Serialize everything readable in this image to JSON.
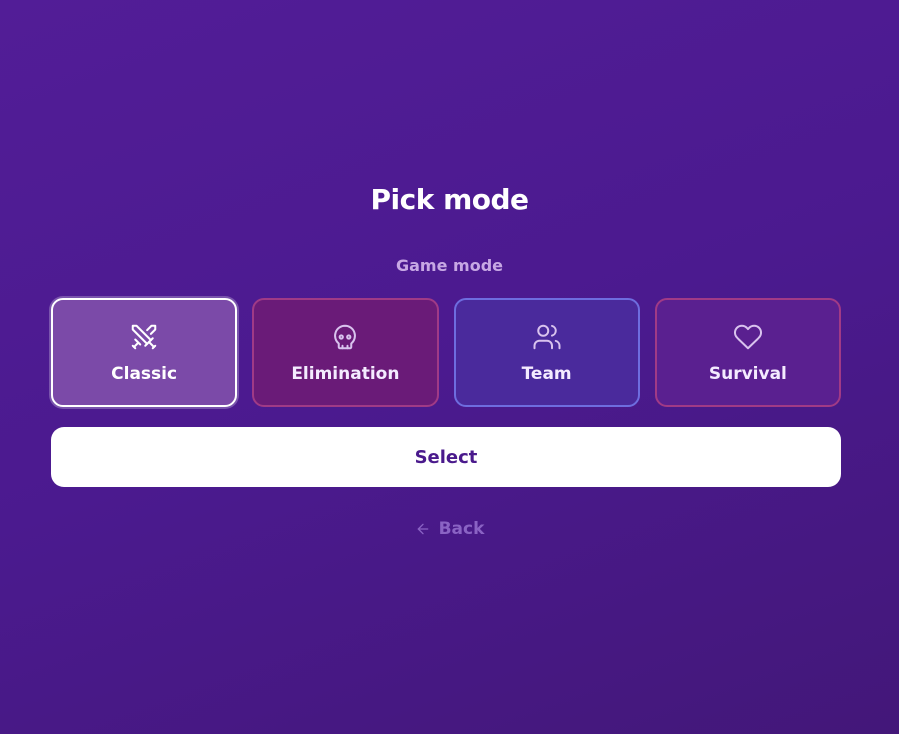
{
  "header": {
    "title": "Pick mode",
    "subtitle": "Game mode"
  },
  "modes": [
    {
      "label": "Classic",
      "icon": "crossed-swords-icon",
      "selected": true
    },
    {
      "label": "Elimination",
      "icon": "skull-icon",
      "selected": false
    },
    {
      "label": "Team",
      "icon": "users-icon",
      "selected": false
    },
    {
      "label": "Survival",
      "icon": "heart-icon",
      "selected": false
    }
  ],
  "actions": {
    "select_label": "Select",
    "back_label": "Back",
    "back_icon": "arrow-left-icon"
  },
  "colors": {
    "background": "#4b1a8f",
    "select_text": "#4a1a8c"
  }
}
